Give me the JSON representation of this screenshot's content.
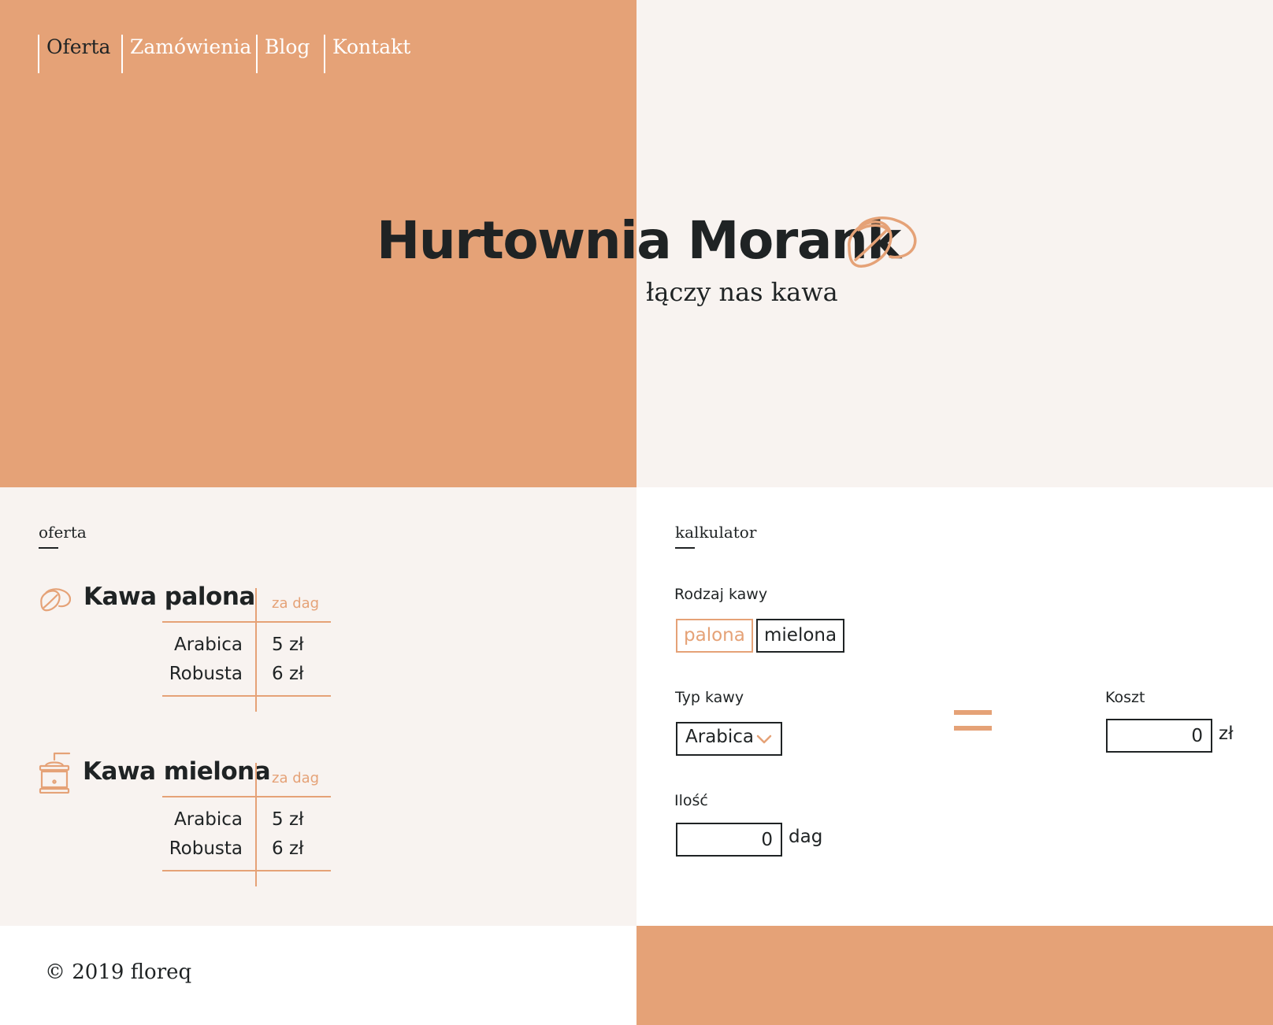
{
  "nav": {
    "items": [
      {
        "label": "Oferta"
      },
      {
        "label": "Zamówienia"
      },
      {
        "label": "Blog"
      },
      {
        "label": "Kontakt"
      }
    ]
  },
  "hero": {
    "title": "Hurtownia Morank",
    "subtitle": "łączy nas kawa",
    "logo_icon": "coffee-bean-icon"
  },
  "offer": {
    "section_label": "oferta",
    "products": [
      {
        "title": "Kawa palona",
        "icon": "coffee-bean-icon",
        "unit_header": "za dag",
        "rows": [
          {
            "name": "Arabica",
            "price": "5 zł"
          },
          {
            "name": "Robusta",
            "price": "6 zł"
          }
        ]
      },
      {
        "title": "Kawa mielona",
        "icon": "coffee-grinder-icon",
        "unit_header": "za dag",
        "rows": [
          {
            "name": "Arabica",
            "price": "5 zł"
          },
          {
            "name": "Robusta",
            "price": "6 zł"
          }
        ]
      }
    ]
  },
  "calculator": {
    "section_label": "kalkulator",
    "coffee_kind_label": "Rodzaj kawy",
    "coffee_kinds": [
      {
        "label": "palona",
        "selected": true
      },
      {
        "label": "mielona",
        "selected": false
      }
    ],
    "coffee_type_label": "Typ kawy",
    "coffee_type_value": "Arabica",
    "quantity_label": "Ilość",
    "quantity_value": "0",
    "quantity_unit": "dag",
    "cost_label": "Koszt",
    "cost_value": "0",
    "cost_unit": "zł"
  },
  "footer": {
    "copyright": "© 2019 floreq"
  },
  "colors": {
    "accent": "#e5a277",
    "text": "#1f2324",
    "light_bg": "#f8f3f0"
  }
}
